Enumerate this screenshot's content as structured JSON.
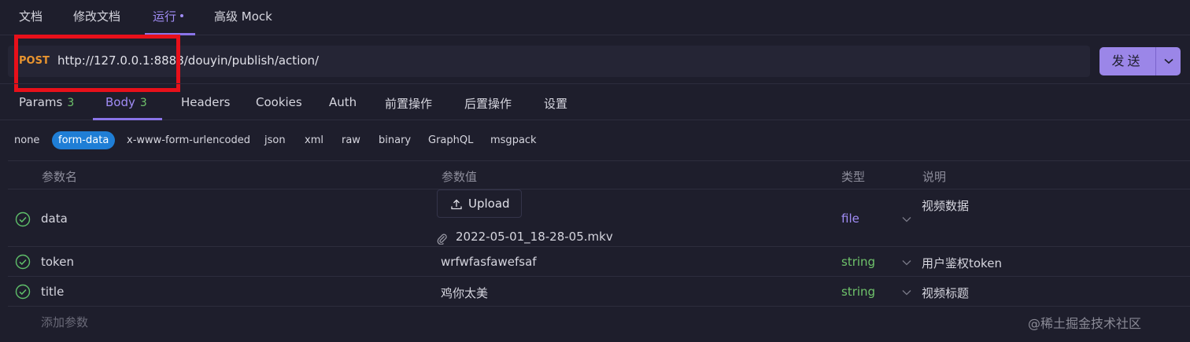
{
  "top_tabs": [
    {
      "label": "文档"
    },
    {
      "label": "修改文档"
    },
    {
      "label": "运行"
    },
    {
      "label": "高级 Mock"
    }
  ],
  "request": {
    "method": "POST",
    "url": "http://127.0.0.1:8888/douyin/publish/action/",
    "send_label": "发送"
  },
  "sub_tabs": [
    {
      "label": "Params",
      "count": "3"
    },
    {
      "label": "Body",
      "count": "3"
    },
    {
      "label": "Headers"
    },
    {
      "label": "Cookies"
    },
    {
      "label": "Auth"
    },
    {
      "label": "前置操作"
    },
    {
      "label": "后置操作"
    },
    {
      "label": "设置"
    }
  ],
  "body_types": [
    "none",
    "form-data",
    "x-www-form-urlencoded",
    "json",
    "xml",
    "raw",
    "binary",
    "GraphQL",
    "msgpack"
  ],
  "body_type_selected": "form-data",
  "table": {
    "headers": {
      "name": "参数名",
      "value": "参数值",
      "type": "类型",
      "desc": "说明"
    },
    "rows": [
      {
        "name": "data",
        "upload_label": "Upload",
        "file_name": "2022-05-01_18-28-05.mkv",
        "type": "file",
        "desc": "视频数据"
      },
      {
        "name": "token",
        "value": "wrfwfasfawefsaf",
        "type": "string",
        "desc": "用户鉴权token"
      },
      {
        "name": "title",
        "value": "鸡你太美",
        "type": "string",
        "desc": "视频标题"
      }
    ],
    "add_placeholder": "添加参数"
  },
  "watermark": "@稀土掘金技术社区",
  "colors": {
    "accent": "#a08cf5",
    "method": "#e8942f",
    "string_type": "#6fc36b",
    "selected_chip": "#1f7ed6",
    "highlight_box": "#e8101a"
  }
}
